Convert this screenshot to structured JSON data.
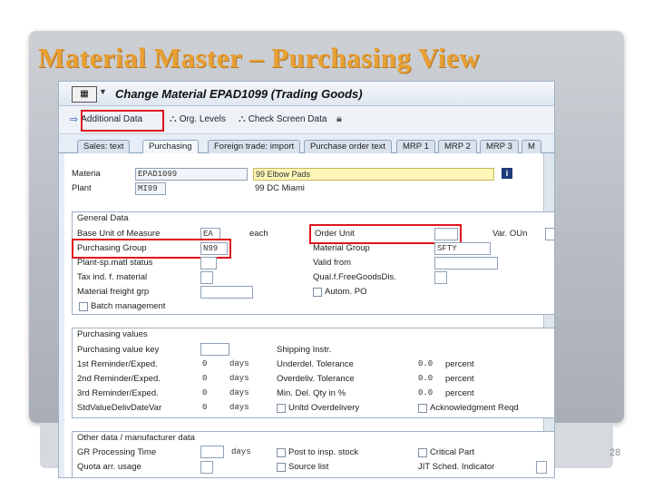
{
  "slide": {
    "title": "Material Master – Purchasing View",
    "page_number": "28"
  },
  "window": {
    "title": "Change Material EPAD1099 (Trading Goods)"
  },
  "toolbar": {
    "additional_data": "Additional Data",
    "org_levels": "Org. Levels",
    "check_screen_data": "Check Screen Data"
  },
  "tabs": [
    {
      "label": "Sales: text"
    },
    {
      "label": "Purchasing"
    },
    {
      "label": "Foreign trade: import"
    },
    {
      "label": "Purchase order text"
    },
    {
      "label": "MRP 1"
    },
    {
      "label": "MRP 2"
    },
    {
      "label": "MRP 3"
    },
    {
      "label": "M"
    }
  ],
  "header": {
    "material_label": "Materia",
    "material_value": "EPAD1099",
    "material_desc": "99 Elbow Pads",
    "plant_label": "Plant",
    "plant_value": "MI99",
    "plant_desc": "99 DC Miami"
  },
  "general_data": {
    "title": "General Data",
    "base_uom_label": "Base Unit of Measure",
    "base_uom_value": "EA",
    "base_uom_text": "each",
    "order_unit_label": "Order Unit",
    "var_oun_label": "Var. OUn",
    "purchasing_group_label": "Purchasing Group",
    "purchasing_group_value": "N99",
    "material_group_label": "Material Group",
    "material_group_value": "SFTY",
    "plant_status_label": "Plant-sp.matl status",
    "valid_from_label": "Valid from",
    "tax_ind_label": "Tax ind. f. material",
    "qual_free_label": "Qual.f.FreeGoodsDis.",
    "freight_label": "Material freight grp",
    "autom_po_label": "Autom. PO",
    "batch_label": "Batch management"
  },
  "purchasing_values": {
    "title": "Purchasing values",
    "pur_value_key_label": "Purchasing value key",
    "shipping_instr_label": "Shipping Instr.",
    "reminder1_label": "1st Reminder/Exped.",
    "reminder1_value": "0",
    "reminder1_unit": "days",
    "underdel_label": "Underdel. Tolerance",
    "underdel_value": "0.0",
    "underdel_unit": "percent",
    "reminder2_label": "2nd Reminder/Exped.",
    "reminder2_value": "0",
    "reminder2_unit": "days",
    "overdel_label": "Overdeliv. Tolerance",
    "overdel_value": "0.0",
    "overdel_unit": "percent",
    "reminder3_label": "3rd Reminder/Exped.",
    "reminder3_value": "0",
    "reminder3_unit": "days",
    "min_del_label": "Min. Del. Qty in %",
    "min_del_value": "0.0",
    "min_del_unit": "percent",
    "stdval_label": "StdValueDelivDateVar",
    "stdval_value": "0",
    "stdval_unit": "days",
    "unltd_label": "Unltd Overdelivery",
    "ack_label": "Acknowledgment Reqd"
  },
  "other_data": {
    "title": "Other data / manufacturer data",
    "gr_time_label": "GR Processing Time",
    "gr_time_unit": "days",
    "post_insp_label": "Post to insp. stock",
    "critical_label": "Critical Part",
    "quota_label": "Quota arr. usage",
    "source_list_label": "Source list",
    "jit_label": "JIT Sched. Indicator"
  },
  "colors": {
    "title_orange": "#e8a033",
    "highlight_red": "#e0141e",
    "sap_blue_bg": "#e6edf6",
    "required_yellow": "#fff6b8"
  }
}
